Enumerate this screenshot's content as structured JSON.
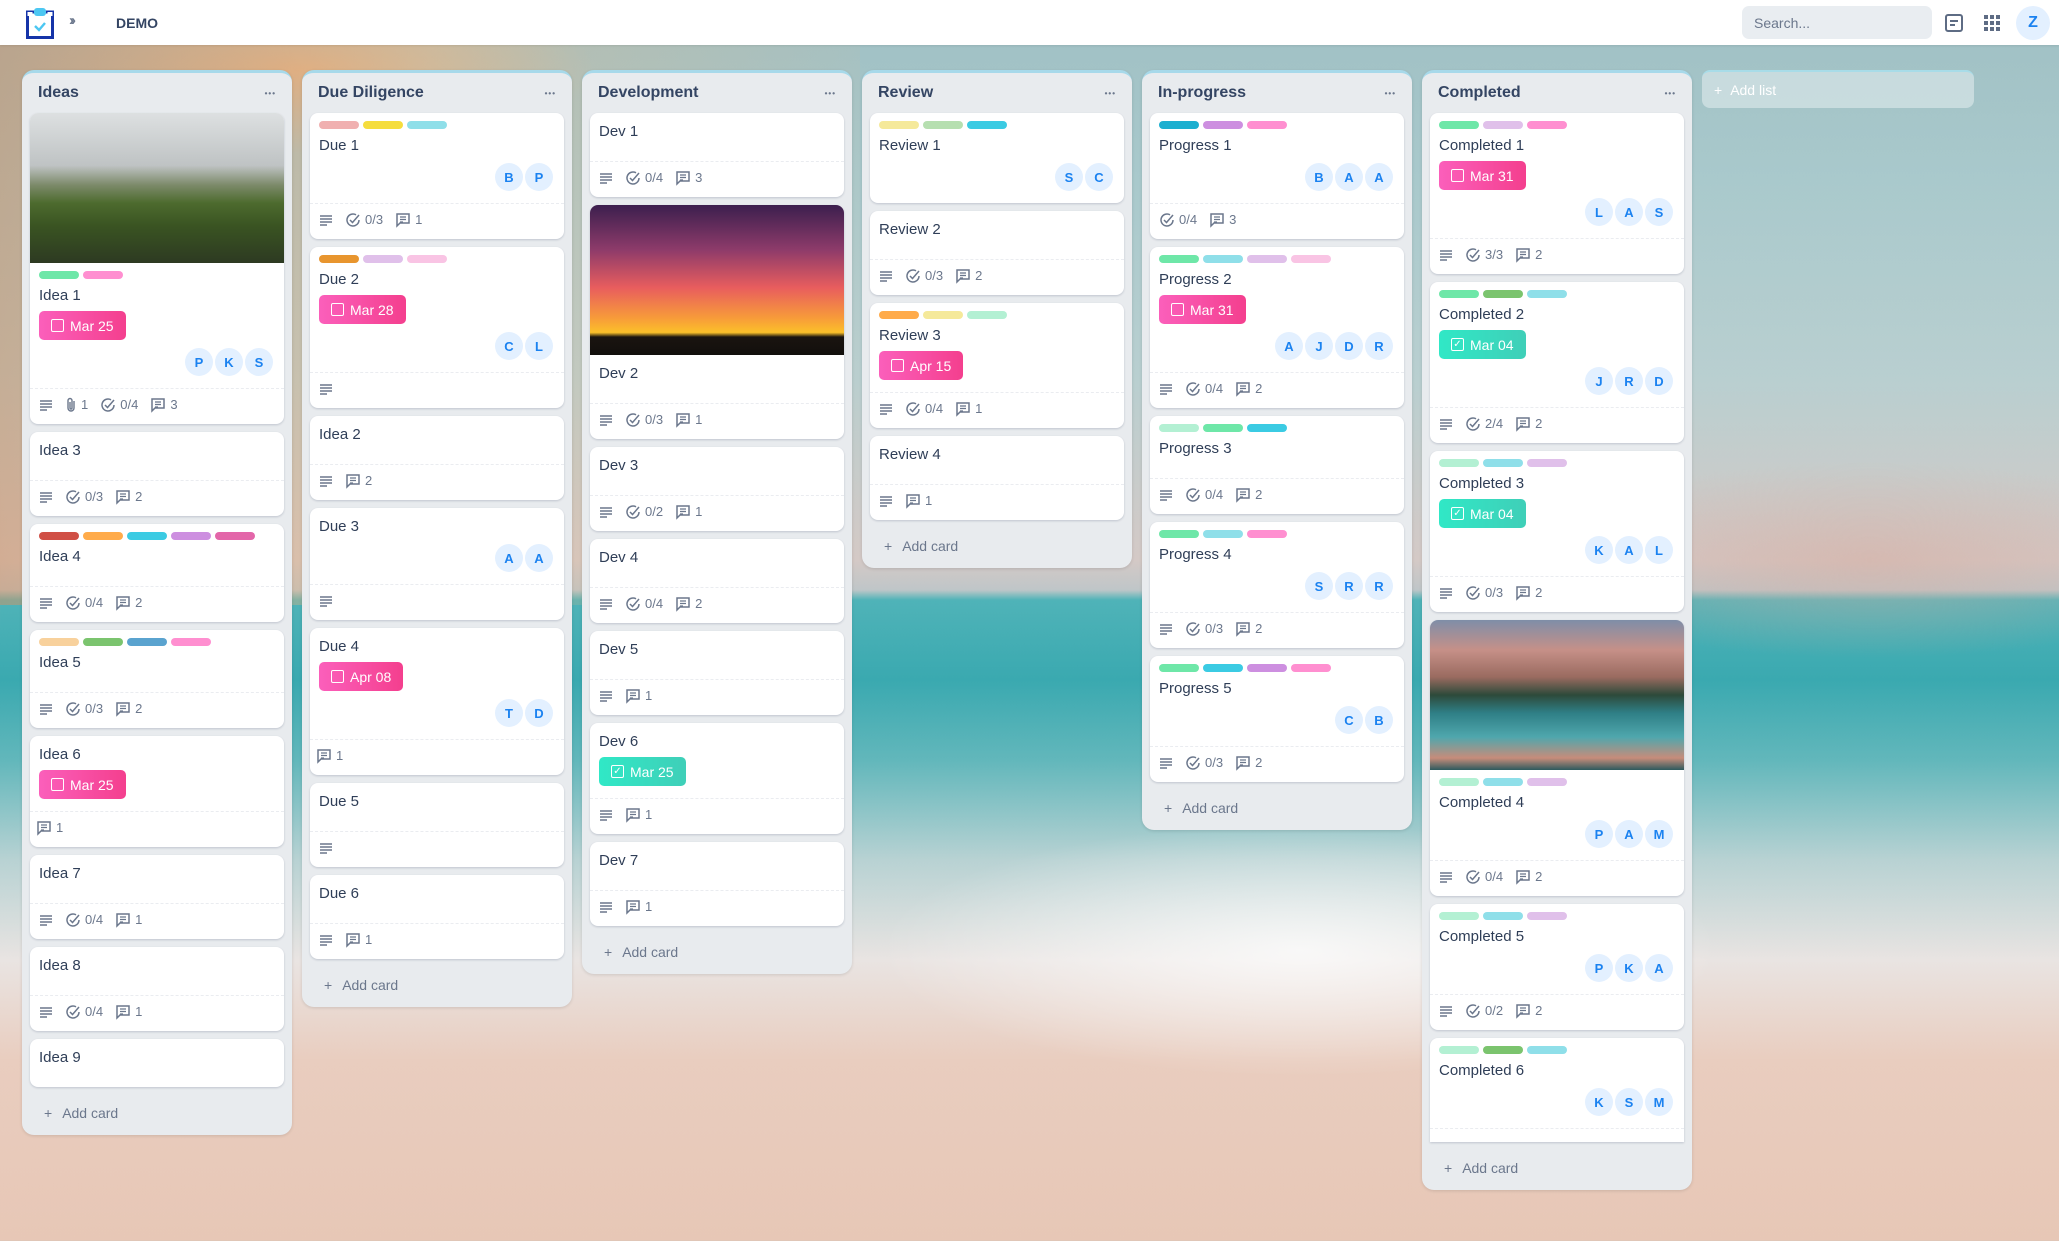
{
  "header": {
    "logo_icon": "clipboard-check-icon",
    "expand_icon": "double-chevron-right-icon",
    "board_title": "DEMO",
    "search_placeholder": "Search...",
    "icons": [
      "activity-log-icon",
      "apps-grid-icon"
    ],
    "user_initial": "Z"
  },
  "colors": {
    "due_pending": "#f43f8e",
    "due_done": "#3fcfb8",
    "avatar_bg": "#e3f0ff",
    "avatar_text": "#1b82f0"
  },
  "add_card_label": "Add card",
  "add_list_label": "Add list",
  "lists": [
    {
      "title": "Ideas",
      "cards": [
        {
          "title": "Idea 1",
          "image": "mountain-road-photo",
          "labels": [
            "#6ee7a8",
            "#ff8fd0"
          ],
          "due": {
            "date": "Mar 25",
            "done": false
          },
          "members": [
            "P",
            "K",
            "S"
          ],
          "description": true,
          "attachments": "1",
          "checklist": "0/4",
          "comments": "3"
        },
        {
          "title": "Idea 3",
          "labels": [],
          "members": [],
          "description": true,
          "checklist": "0/3",
          "comments": "2"
        },
        {
          "title": "Idea 4",
          "labels": [
            "#d04f45",
            "#ffab4a",
            "#3bcbe3",
            "#cd8fe0",
            "#e366a9"
          ],
          "members": [],
          "description": true,
          "checklist": "0/4",
          "comments": "2"
        },
        {
          "title": "Idea 5",
          "labels": [
            "#f8d19c",
            "#7bc46e",
            "#5aa3cf",
            "#ff8fd0"
          ],
          "members": [],
          "description": true,
          "checklist": "0/3",
          "comments": "2"
        },
        {
          "title": "Idea 6",
          "labels": [],
          "due": {
            "date": "Mar 25",
            "done": false
          },
          "members": [],
          "comments": "1"
        },
        {
          "title": "Idea 7",
          "labels": [],
          "members": [],
          "description": true,
          "checklist": "0/4",
          "comments": "1"
        },
        {
          "title": "Idea 8",
          "labels": [],
          "members": [],
          "description": true,
          "checklist": "0/4",
          "comments": "1"
        },
        {
          "title": "Idea 9",
          "labels": [],
          "members": [],
          "nofoot": true
        }
      ]
    },
    {
      "title": "Due Diligence",
      "cards": [
        {
          "title": "Due 1",
          "labels": [
            "#f0b0b0",
            "#f5dd3d",
            "#8fdfe9"
          ],
          "members": [
            "B",
            "P"
          ],
          "description": true,
          "checklist": "0/3",
          "comments": "1"
        },
        {
          "title": "Due 2",
          "labels": [
            "#e8952e",
            "#e0c0ea",
            "#f9c4e4"
          ],
          "due": {
            "date": "Mar 28",
            "done": false
          },
          "members": [
            "C",
            "L"
          ],
          "description": true
        },
        {
          "title": "Idea 2",
          "labels": [],
          "members": [],
          "description": true,
          "comments": "2"
        },
        {
          "title": "Due 3",
          "labels": [],
          "members": [
            "A",
            "A"
          ],
          "description": true
        },
        {
          "title": "Due 4",
          "labels": [],
          "due": {
            "date": "Apr 08",
            "done": false
          },
          "members": [
            "T",
            "D"
          ],
          "comments": "1"
        },
        {
          "title": "Due 5",
          "labels": [],
          "members": [],
          "description": true
        },
        {
          "title": "Due 6",
          "labels": [],
          "members": [],
          "description": true,
          "comments": "1"
        }
      ]
    },
    {
      "title": "Development",
      "cards": [
        {
          "title": "Dev 1",
          "labels": [],
          "members": [],
          "description": true,
          "checklist": "0/4",
          "comments": "3"
        },
        {
          "title": "Dev 2",
          "image": "palm-sunset-photo",
          "labels": [],
          "members": [],
          "description": true,
          "checklist": "0/3",
          "comments": "1"
        },
        {
          "title": "Dev 3",
          "labels": [],
          "members": [],
          "description": true,
          "checklist": "0/2",
          "comments": "1"
        },
        {
          "title": "Dev 4",
          "labels": [],
          "members": [],
          "description": true,
          "checklist": "0/4",
          "comments": "2"
        },
        {
          "title": "Dev 5",
          "labels": [],
          "members": [],
          "description": true,
          "comments": "1"
        },
        {
          "title": "Dev 6",
          "labels": [],
          "due": {
            "date": "Mar 25",
            "done": true
          },
          "members": [],
          "description": true,
          "comments": "1"
        },
        {
          "title": "Dev 7",
          "labels": [],
          "members": [],
          "description": true,
          "comments": "1"
        }
      ]
    },
    {
      "title": "Review",
      "cards": [
        {
          "title": "Review 1",
          "labels": [
            "#f5e99a",
            "#b6dfb0",
            "#3bcbe3"
          ],
          "members": [
            "S",
            "C"
          ],
          "nofoot": true
        },
        {
          "title": "Review 2",
          "labels": [],
          "members": [],
          "description": true,
          "checklist": "0/3",
          "comments": "2"
        },
        {
          "title": "Review 3",
          "labels": [
            "#ffab4a",
            "#f5e99a",
            "#b3f0d3"
          ],
          "due": {
            "date": "Apr 15",
            "done": false
          },
          "members": [],
          "description": true,
          "checklist": "0/4",
          "comments": "1"
        },
        {
          "title": "Review 4",
          "labels": [],
          "members": [],
          "description": true,
          "comments": "1"
        }
      ]
    },
    {
      "title": "In-progress",
      "cards": [
        {
          "title": "Progress 1",
          "labels": [
            "#1cafd0",
            "#cd8fe0",
            "#ff8fd0"
          ],
          "members": [
            "B",
            "A",
            "A"
          ],
          "checklist": "0/4",
          "comments": "3"
        },
        {
          "title": "Progress 2",
          "labels": [
            "#6ee7a8",
            "#8fdfe9",
            "#e0c0ea",
            "#f9c4e4"
          ],
          "due": {
            "date": "Mar 31",
            "done": false
          },
          "members": [
            "A",
            "J",
            "D",
            "R"
          ],
          "description": true,
          "checklist": "0/4",
          "comments": "2"
        },
        {
          "title": "Progress 3",
          "labels": [
            "#b3f0d3",
            "#6ee7a8",
            "#3bcbe3"
          ],
          "members": [],
          "description": true,
          "checklist": "0/4",
          "comments": "2"
        },
        {
          "title": "Progress 4",
          "labels": [
            "#6ee7a8",
            "#8fdfe9",
            "#ff8fd0"
          ],
          "members": [
            "S",
            "R",
            "R"
          ],
          "description": true,
          "checklist": "0/3",
          "comments": "2"
        },
        {
          "title": "Progress 5",
          "labels": [
            "#6ee7a8",
            "#3bcbe3",
            "#cd8fe0",
            "#ff8fd0"
          ],
          "members": [
            "C",
            "B"
          ],
          "description": true,
          "checklist": "0/3",
          "comments": "2"
        }
      ]
    },
    {
      "title": "Completed",
      "cards": [
        {
          "title": "Completed 1",
          "labels": [
            "#6ee7a8",
            "#e0c0ea",
            "#ff8fd0"
          ],
          "due": {
            "date": "Mar 31",
            "done": false
          },
          "members": [
            "L",
            "A",
            "S"
          ],
          "description": true,
          "checklist": "3/3",
          "comments": "2"
        },
        {
          "title": "Completed 2",
          "labels": [
            "#6ee7a8",
            "#7bc46e",
            "#8fdfe9"
          ],
          "due": {
            "date": "Mar 04",
            "done": true
          },
          "members": [
            "J",
            "R",
            "D"
          ],
          "description": true,
          "checklist": "2/4",
          "comments": "2"
        },
        {
          "title": "Completed 3",
          "labels": [
            "#b3f0d3",
            "#8fdfe9",
            "#e0c0ea"
          ],
          "due": {
            "date": "Mar 04",
            "done": true
          },
          "members": [
            "K",
            "A",
            "L"
          ],
          "description": true,
          "checklist": "0/3",
          "comments": "2"
        },
        {
          "title": "Completed 4",
          "image": "mountain-lake-photo",
          "labels": [
            "#b3f0d3",
            "#8fdfe9",
            "#e0c0ea"
          ],
          "members": [
            "P",
            "A",
            "M"
          ],
          "description": true,
          "checklist": "0/4",
          "comments": "2"
        },
        {
          "title": "Completed 5",
          "labels": [
            "#b3f0d3",
            "#8fdfe9",
            "#e0c0ea"
          ],
          "members": [
            "P",
            "K",
            "A"
          ],
          "description": true,
          "checklist": "0/2",
          "comments": "2"
        },
        {
          "title": "Completed 6",
          "labels": [
            "#b3f0d3",
            "#7bc46e",
            "#8fdfe9"
          ],
          "members": [
            "K",
            "S",
            "M"
          ],
          "nofoot": true,
          "cut": true
        }
      ]
    }
  ]
}
